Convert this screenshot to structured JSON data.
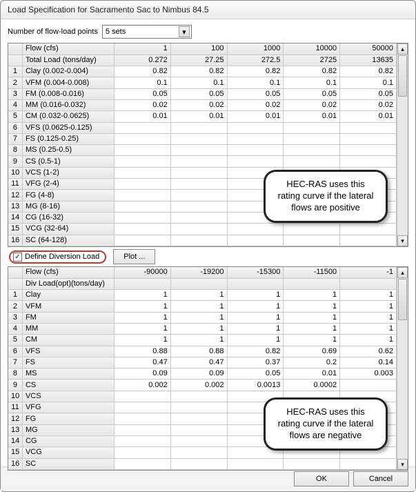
{
  "title": "Load Specification for Sacramento Sac to Nimbus 84.5",
  "num_points_label": "Number of flow-load points",
  "num_points_value": "5 sets",
  "table1": {
    "header_rows": [
      {
        "num": "",
        "label": "Flow (cfs)",
        "vals": [
          "1",
          "100",
          "1000",
          "10000",
          "50000"
        ]
      },
      {
        "num": "",
        "label": "Total Load (tons/day)",
        "vals": [
          "0.272",
          "27.25",
          "272.5",
          "2725",
          "13635"
        ]
      }
    ],
    "rows": [
      {
        "num": "1",
        "label": "Clay (0.002-0.004)",
        "vals": [
          "0.82",
          "0.82",
          "0.82",
          "0.82",
          "0.82"
        ]
      },
      {
        "num": "2",
        "label": "VFM (0.004-0.008)",
        "vals": [
          "0.1",
          "0.1",
          "0.1",
          "0.1",
          "0.1"
        ]
      },
      {
        "num": "3",
        "label": "FM (0.008-0.016)",
        "vals": [
          "0.05",
          "0.05",
          "0.05",
          "0.05",
          "0.05"
        ]
      },
      {
        "num": "4",
        "label": "MM (0.016-0.032)",
        "vals": [
          "0.02",
          "0.02",
          "0.02",
          "0.02",
          "0.02"
        ]
      },
      {
        "num": "5",
        "label": "CM (0.032-0.0625)",
        "vals": [
          "0.01",
          "0.01",
          "0.01",
          "0.01",
          "0.01"
        ]
      },
      {
        "num": "6",
        "label": "VFS (0.0625-0.125)",
        "vals": [
          "",
          "",
          "",
          "",
          ""
        ]
      },
      {
        "num": "7",
        "label": "FS (0.125-0.25)",
        "vals": [
          "",
          "",
          "",
          "",
          ""
        ]
      },
      {
        "num": "8",
        "label": "MS (0.25-0.5)",
        "vals": [
          "",
          "",
          "",
          "",
          ""
        ]
      },
      {
        "num": "9",
        "label": "CS (0.5-1)",
        "vals": [
          "",
          "",
          "",
          "",
          ""
        ]
      },
      {
        "num": "10",
        "label": "VCS (1-2)",
        "vals": [
          "",
          "",
          "",
          "",
          ""
        ]
      },
      {
        "num": "11",
        "label": "VFG (2-4)",
        "vals": [
          "",
          "",
          "",
          "",
          ""
        ]
      },
      {
        "num": "12",
        "label": "FG (4-8)",
        "vals": [
          "",
          "",
          "",
          "",
          ""
        ]
      },
      {
        "num": "13",
        "label": "MG (8-16)",
        "vals": [
          "",
          "",
          "",
          "",
          ""
        ]
      },
      {
        "num": "14",
        "label": "CG (16-32)",
        "vals": [
          "",
          "",
          "",
          "",
          ""
        ]
      },
      {
        "num": "15",
        "label": "VCG (32-64)",
        "vals": [
          "",
          "",
          "",
          "",
          ""
        ]
      },
      {
        "num": "16",
        "label": "SC (64-128)",
        "vals": [
          "",
          "",
          "",
          "",
          ""
        ]
      }
    ]
  },
  "diversion_checkbox_label": "Define Diversion Load",
  "diversion_checkbox_checked": "✓",
  "plot_button_label": "Plot ...",
  "table2": {
    "header_rows": [
      {
        "num": "",
        "label": "Flow (cfs)",
        "vals": [
          "-90000",
          "-19200",
          "-15300",
          "-11500",
          "-1"
        ]
      },
      {
        "num": "",
        "label": "Div Load(opt)(tons/day)",
        "vals": [
          "",
          "",
          "",
          "",
          ""
        ]
      }
    ],
    "rows": [
      {
        "num": "1",
        "label": "Clay",
        "vals": [
          "1",
          "1",
          "1",
          "1",
          "1"
        ]
      },
      {
        "num": "2",
        "label": "VFM",
        "vals": [
          "1",
          "1",
          "1",
          "1",
          "1"
        ]
      },
      {
        "num": "3",
        "label": "FM",
        "vals": [
          "1",
          "1",
          "1",
          "1",
          "1"
        ]
      },
      {
        "num": "4",
        "label": "MM",
        "vals": [
          "1",
          "1",
          "1",
          "1",
          "1"
        ]
      },
      {
        "num": "5",
        "label": "CM",
        "vals": [
          "1",
          "1",
          "1",
          "1",
          "1"
        ]
      },
      {
        "num": "6",
        "label": "VFS",
        "vals": [
          "0.88",
          "0.88",
          "0.82",
          "0.69",
          "0.62"
        ]
      },
      {
        "num": "7",
        "label": "FS",
        "vals": [
          "0.47",
          "0.47",
          "0.37",
          "0.2",
          "0.14"
        ]
      },
      {
        "num": "8",
        "label": "MS",
        "vals": [
          "0.09",
          "0.09",
          "0.05",
          "0.01",
          "0.003"
        ]
      },
      {
        "num": "9",
        "label": "CS",
        "vals": [
          "0.002",
          "0.002",
          "0.0013",
          "0.0002",
          ""
        ]
      },
      {
        "num": "10",
        "label": "VCS",
        "vals": [
          "",
          "",
          "",
          "",
          ""
        ]
      },
      {
        "num": "11",
        "label": "VFG",
        "vals": [
          "",
          "",
          "",
          "",
          ""
        ]
      },
      {
        "num": "12",
        "label": "FG",
        "vals": [
          "",
          "",
          "",
          "",
          ""
        ]
      },
      {
        "num": "13",
        "label": "MG",
        "vals": [
          "",
          "",
          "",
          "",
          ""
        ]
      },
      {
        "num": "14",
        "label": "CG",
        "vals": [
          "",
          "",
          "",
          "",
          ""
        ]
      },
      {
        "num": "15",
        "label": "VCG",
        "vals": [
          "",
          "",
          "",
          "",
          ""
        ]
      },
      {
        "num": "16",
        "label": "SC",
        "vals": [
          "",
          "",
          "",
          "",
          ""
        ]
      }
    ]
  },
  "ok_label": "OK",
  "cancel_label": "Cancel",
  "callout1": "HEC-RAS uses this rating curve if the lateral flows are positive",
  "callout2": "HEC-RAS uses this rating curve if the lateral flows are negative"
}
